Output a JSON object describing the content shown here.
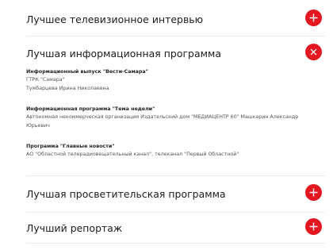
{
  "accent": "#e4161f",
  "accordion": [
    {
      "title": "Лучшее телевизионное интервью",
      "state": "collapsed",
      "icon": "plus-icon"
    },
    {
      "title": "Лучшая информационная программа",
      "state": "expanded",
      "icon": "close-icon",
      "entries": [
        {
          "title": "Информационный выпуск \"Вести-Самара\"",
          "lines": [
            "ГТРК \"Самара\"",
            "Тумбарцева Ирина Николаевна"
          ]
        },
        {
          "title": "Информационная программа \"Тема недели\"",
          "lines": [
            "Автономная некоммерческая организация Издательский дом \"МЕДИАЦЕНТР 60\" Машкарин Александр",
            "Юрьевич"
          ]
        },
        {
          "title": "Программа \"Главные новости\"",
          "lines": [
            "АО \"Областной телерадиовещательный канал\", телеканал \"Первый Областной\""
          ]
        }
      ]
    },
    {
      "title": "Лучшая просветительская программа",
      "state": "collapsed",
      "icon": "plus-icon"
    },
    {
      "title": "Лучший репортаж",
      "state": "collapsed",
      "icon": "plus-icon"
    }
  ]
}
